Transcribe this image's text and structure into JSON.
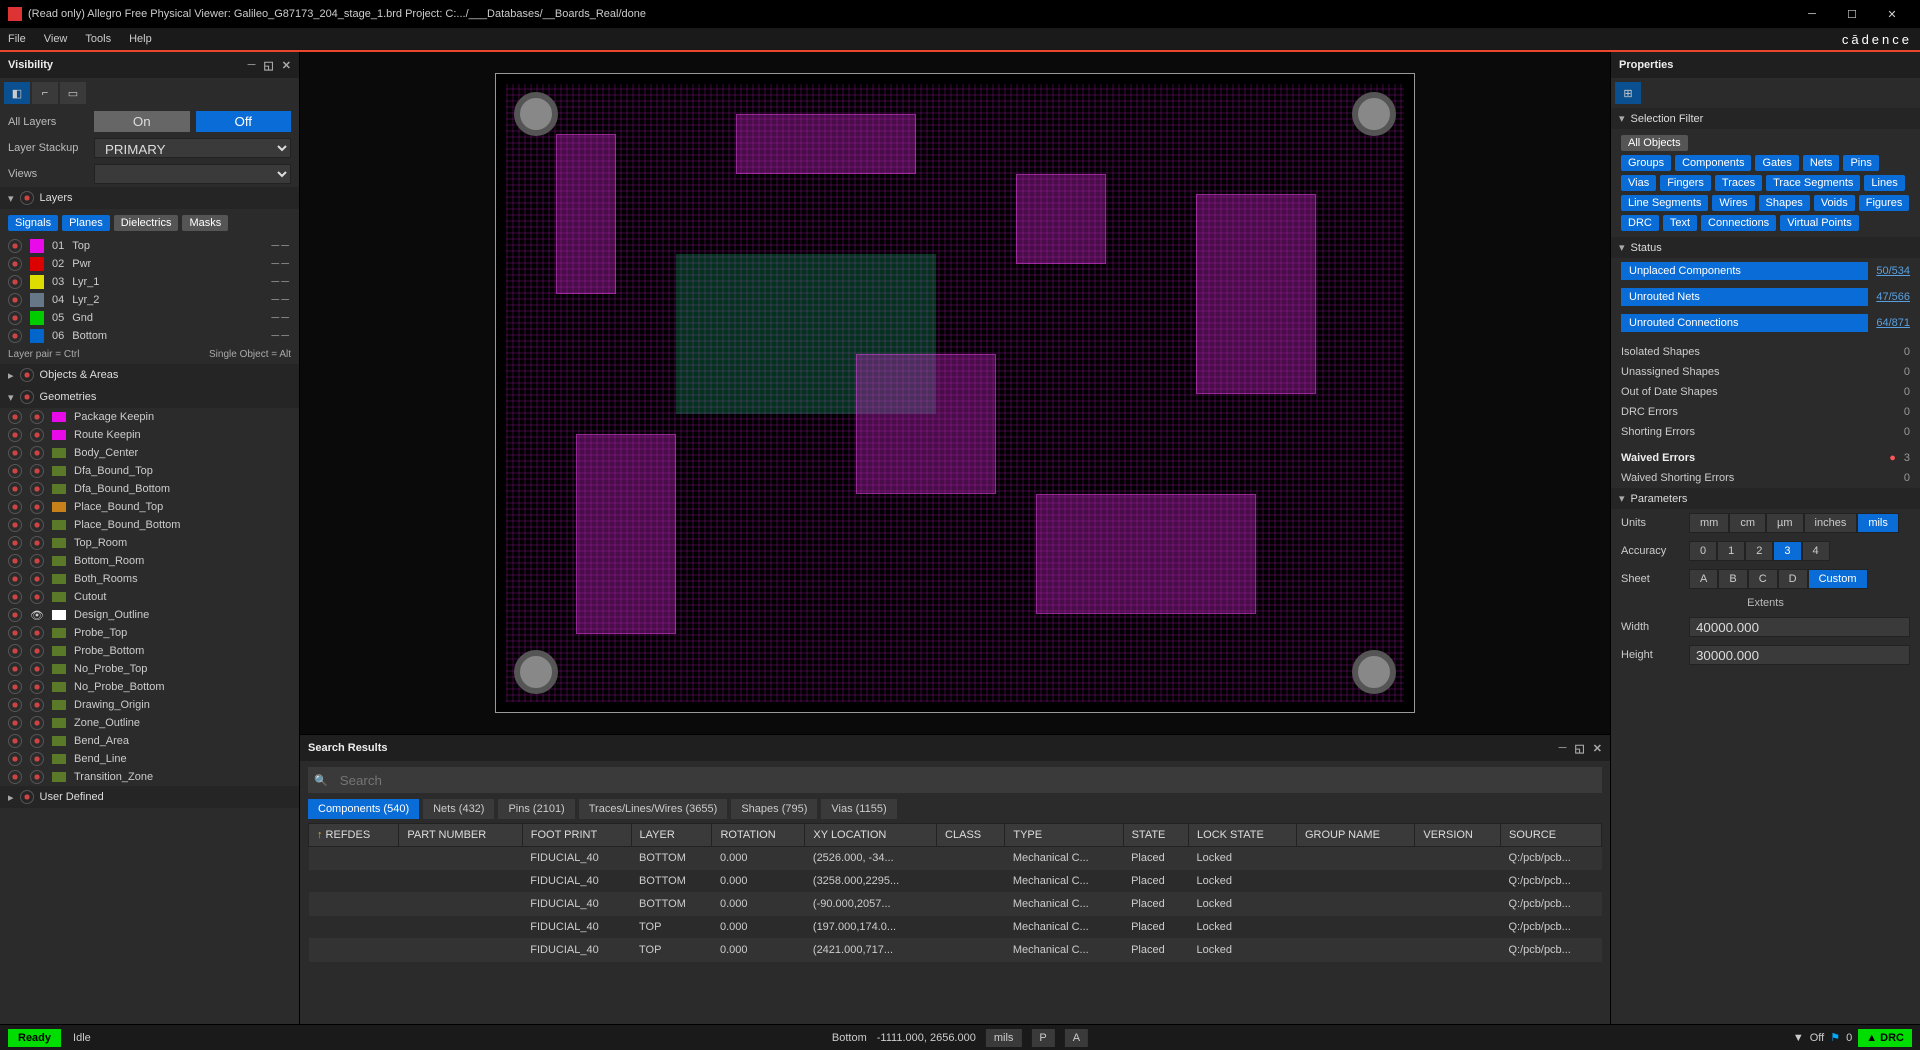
{
  "title": "(Read only) Allegro Free Physical Viewer: Galileo_G87173_204_stage_1.brd   Project: C:.../___Databases/__Boards_Real/done",
  "menu": [
    "File",
    "View",
    "Tools",
    "Help"
  ],
  "brand": "cādence",
  "visibility": {
    "title": "Visibility",
    "allLayersLabel": "All Layers",
    "on": "On",
    "off": "Off",
    "layerStackupLabel": "Layer Stackup",
    "layerStackupValue": "PRIMARY",
    "viewsLabel": "Views",
    "layersHdr": "Layers",
    "layerTabs": [
      "Signals",
      "Planes",
      "Dielectrics",
      "Masks"
    ],
    "layers": [
      {
        "num": "01",
        "name": "Top",
        "color": "#e80ae8"
      },
      {
        "num": "02",
        "name": "Pwr",
        "color": "#d00"
      },
      {
        "num": "03",
        "name": "Lyr_1",
        "color": "#dd0"
      },
      {
        "num": "04",
        "name": "Lyr_2",
        "color": "#678"
      },
      {
        "num": "05",
        "name": "Gnd",
        "color": "#0c0"
      },
      {
        "num": "06",
        "name": "Bottom",
        "color": "#06c"
      }
    ],
    "layerPair": "Layer pair = Ctrl",
    "singleObj": "Single Object = Alt",
    "objectsHdr": "Objects & Areas",
    "geomHdr": "Geometries",
    "geoms": [
      {
        "name": "Package Keepin",
        "c": "#e80ae8"
      },
      {
        "name": "Route Keepin",
        "c": "#e80ae8"
      },
      {
        "name": "Body_Center",
        "c": "#5a7a2a"
      },
      {
        "name": "Dfa_Bound_Top",
        "c": "#5a7a2a"
      },
      {
        "name": "Dfa_Bound_Bottom",
        "c": "#5a7a2a"
      },
      {
        "name": "Place_Bound_Top",
        "c": "#c8801a"
      },
      {
        "name": "Place_Bound_Bottom",
        "c": "#5a7a2a"
      },
      {
        "name": "Top_Room",
        "c": "#5a7a2a"
      },
      {
        "name": "Bottom_Room",
        "c": "#5a7a2a"
      },
      {
        "name": "Both_Rooms",
        "c": "#5a7a2a"
      },
      {
        "name": "Cutout",
        "c": "#5a7a2a"
      },
      {
        "name": "Design_Outline",
        "c": "#fff"
      },
      {
        "name": "Probe_Top",
        "c": "#5a7a2a"
      },
      {
        "name": "Probe_Bottom",
        "c": "#5a7a2a"
      },
      {
        "name": "No_Probe_Top",
        "c": "#5a7a2a"
      },
      {
        "name": "No_Probe_Bottom",
        "c": "#5a7a2a"
      },
      {
        "name": "Drawing_Origin",
        "c": "#5a7a2a"
      },
      {
        "name": "Zone_Outline",
        "c": "#5a7a2a"
      },
      {
        "name": "Bend_Area",
        "c": "#5a7a2a"
      },
      {
        "name": "Bend_Line",
        "c": "#5a7a2a"
      },
      {
        "name": "Transition_Zone",
        "c": "#5a7a2a"
      }
    ],
    "userDefHdr": "User Defined"
  },
  "properties": {
    "title": "Properties",
    "selFilterHdr": "Selection Filter",
    "allObjects": "All Objects",
    "filters": [
      "Groups",
      "Components",
      "Gates",
      "Nets",
      "Pins",
      "Vias",
      "Fingers",
      "Traces",
      "Trace Segments",
      "Lines",
      "Line Segments",
      "Wires",
      "Shapes",
      "Voids",
      "Figures",
      "DRC",
      "Text",
      "Connections",
      "Virtual Points"
    ],
    "statusHdr": "Status",
    "statusItems": [
      {
        "label": "Unplaced Components",
        "link": "50/534"
      },
      {
        "label": "Unrouted Nets",
        "link": "47/566"
      },
      {
        "label": "Unrouted Connections",
        "link": "64/871"
      }
    ],
    "statusRows": [
      {
        "label": "Isolated Shapes",
        "val": "0"
      },
      {
        "label": "Unassigned Shapes",
        "val": "0"
      },
      {
        "label": "Out of Date Shapes",
        "val": "0"
      },
      {
        "label": "DRC Errors",
        "val": "0"
      },
      {
        "label": "Shorting Errors",
        "val": "0"
      }
    ],
    "waived": {
      "label": "Waived Errors",
      "val": "3"
    },
    "waivedShort": {
      "label": "Waived Shorting Errors",
      "val": "0"
    },
    "paramsHdr": "Parameters",
    "units": {
      "label": "Units",
      "opts": [
        "mm",
        "cm",
        "µm",
        "inches",
        "mils"
      ],
      "sel": 4
    },
    "accuracy": {
      "label": "Accuracy",
      "opts": [
        "0",
        "1",
        "2",
        "3",
        "4"
      ],
      "sel": 3
    },
    "sheet": {
      "label": "Sheet",
      "opts": [
        "A",
        "B",
        "C",
        "D",
        "Custom"
      ],
      "sel": 4
    },
    "extents": "Extents",
    "width": {
      "label": "Width",
      "val": "40000.000"
    },
    "height": {
      "label": "Height",
      "val": "30000.000"
    }
  },
  "search": {
    "title": "Search Results",
    "placeholder": "Search",
    "tabs": [
      "Components (540)",
      "Nets (432)",
      "Pins (2101)",
      "Traces/Lines/Wires (3655)",
      "Shapes (795)",
      "Vias (1155)"
    ],
    "cols": [
      "REFDES",
      "PART NUMBER",
      "FOOT PRINT",
      "LAYER",
      "ROTATION",
      "XY LOCATION",
      "CLASS",
      "TYPE",
      "STATE",
      "LOCK STATE",
      "GROUP NAME",
      "VERSION",
      "SOURCE"
    ],
    "rows": [
      [
        "",
        "",
        "FIDUCIAL_40",
        "BOTTOM",
        "0.000",
        "(2526.000, -34...",
        "",
        "Mechanical C...",
        "Placed",
        "Locked",
        "",
        "",
        "Q:/pcb/pcb..."
      ],
      [
        "",
        "",
        "FIDUCIAL_40",
        "BOTTOM",
        "0.000",
        "(3258.000,2295...",
        "",
        "Mechanical C...",
        "Placed",
        "Locked",
        "",
        "",
        "Q:/pcb/pcb..."
      ],
      [
        "",
        "",
        "FIDUCIAL_40",
        "BOTTOM",
        "0.000",
        "(-90.000,2057...",
        "",
        "Mechanical C...",
        "Placed",
        "Locked",
        "",
        "",
        "Q:/pcb/pcb..."
      ],
      [
        "",
        "",
        "FIDUCIAL_40",
        "TOP",
        "0.000",
        "(197.000,174.0...",
        "",
        "Mechanical C...",
        "Placed",
        "Locked",
        "",
        "",
        "Q:/pcb/pcb..."
      ],
      [
        "",
        "",
        "FIDUCIAL_40",
        "TOP",
        "0.000",
        "(2421.000,717...",
        "",
        "Mechanical C...",
        "Placed",
        "Locked",
        "",
        "",
        "Q:/pcb/pcb..."
      ]
    ]
  },
  "status": {
    "ready": "Ready",
    "idle": "Idle",
    "layer": "Bottom",
    "coords": "-1111.000, 2656.000",
    "units": "mils",
    "p": "P",
    "a": "A",
    "off": "Off",
    "on": "0",
    "drc": "DRC"
  }
}
